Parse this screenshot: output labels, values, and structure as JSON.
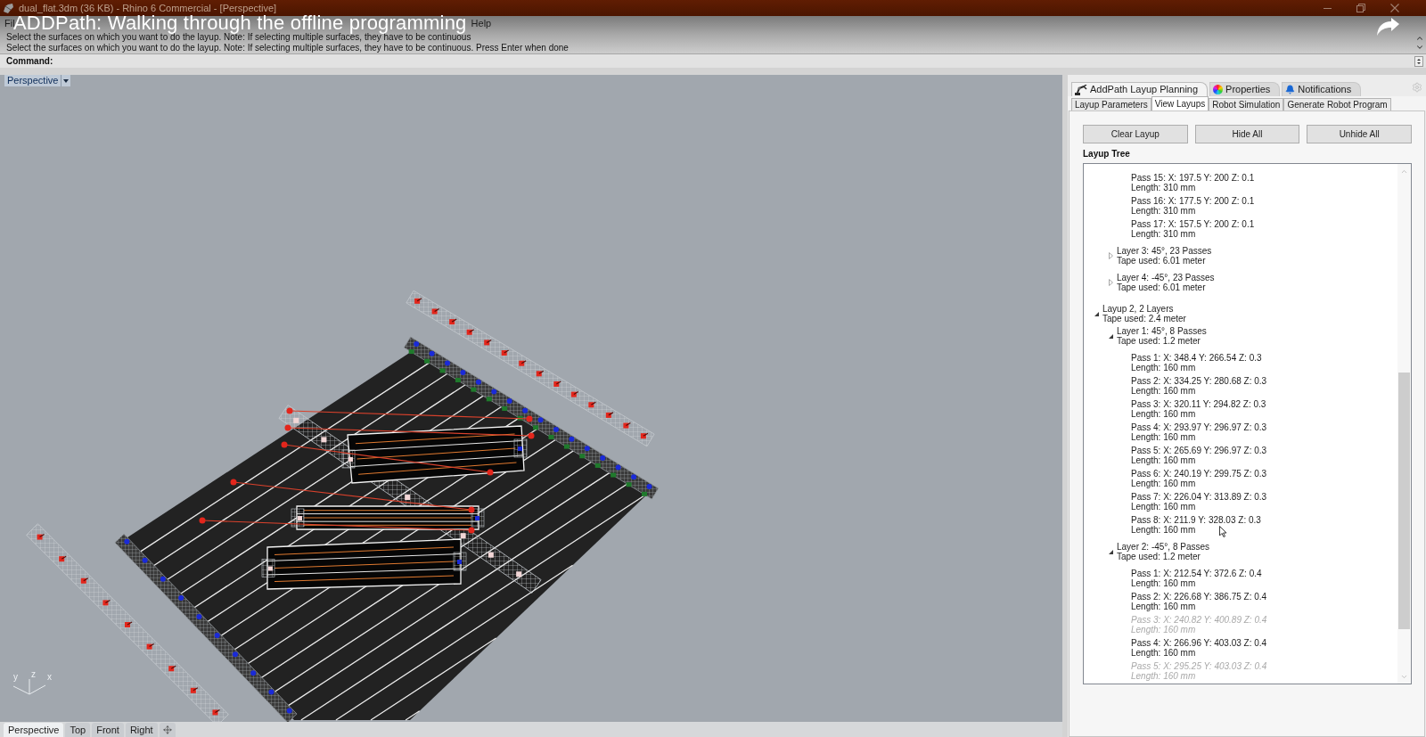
{
  "window": {
    "title": "dual_flat.3dm (36 KB) - Rhino 6 Commercial - [Perspective]"
  },
  "video_title": "ADDPath: Walking through the offline programming",
  "menu": [
    "Fil",
    "Help"
  ],
  "command_history": [
    "Select the surfaces on which you want to do the layup. Note: If selecting multiple surfaces, they have to be continuous",
    "Select the surfaces on which you want to do the layup. Note: If selecting multiple surfaces, they have to be continuous. Press Enter when done"
  ],
  "command": {
    "label": "Command:"
  },
  "viewport": {
    "label": "Perspective",
    "axis_labels": [
      "y",
      "z",
      "x"
    ],
    "tabs": [
      {
        "label": "Perspective",
        "selected": true
      },
      {
        "label": "Top",
        "selected": false
      },
      {
        "label": "Front",
        "selected": false
      },
      {
        "label": "Right",
        "selected": false
      }
    ]
  },
  "panel": {
    "tabs": [
      {
        "label": "AddPath Layup Planning",
        "selected": true
      },
      {
        "label": "Properties",
        "selected": false
      },
      {
        "label": "Notifications",
        "selected": false
      }
    ],
    "subtabs": [
      {
        "label": "Layup Parameters",
        "selected": false
      },
      {
        "label": "View Layups",
        "selected": true
      },
      {
        "label": "Robot Simulation",
        "selected": false
      },
      {
        "label": "Generate Robot Program",
        "selected": false
      }
    ],
    "buttons": [
      "Clear Layup",
      "Hide All",
      "Unhide All"
    ],
    "tree": {
      "title": "Layup Tree",
      "nodes": [
        {
          "kind": "layup",
          "expanded": true,
          "children": [
            {
              "kind": "layer",
              "expanded": true,
              "children": [
                {
                  "kind": "pass",
                  "label": "Pass 15: X: 197.5 Y: 200 Z: 0.1",
                  "detail": "Length: 310 mm",
                  "hidden": false
                },
                {
                  "kind": "pass",
                  "label": "Pass 16: X: 177.5 Y: 200 Z: 0.1",
                  "detail": "Length: 310 mm",
                  "hidden": false
                },
                {
                  "kind": "pass",
                  "label": "Pass 17: X: 157.5 Y: 200 Z: 0.1",
                  "detail": "Length: 310 mm",
                  "hidden": false
                }
              ]
            },
            {
              "kind": "layer",
              "label": "Layer 3: 45°, 23 Passes",
              "detail": "Tape used: 6.01 meter",
              "expanded": false
            },
            {
              "kind": "layer",
              "label": "Layer 4: -45°, 23 Passes",
              "detail": "Tape used: 6.01 meter",
              "expanded": false
            }
          ]
        },
        {
          "kind": "layup",
          "label": "Layup 2, 2 Layers",
          "detail": "Tape used: 2.4 meter",
          "expanded": true,
          "children": [
            {
              "kind": "layer",
              "label": "Layer 1: 45°, 8 Passes",
              "detail": "Tape used: 1.2 meter",
              "expanded": true,
              "children": [
                {
                  "kind": "pass",
                  "label": "Pass 1: X: 348.4 Y: 266.54 Z: 0.3",
                  "detail": "Length: 160 mm",
                  "hidden": false
                },
                {
                  "kind": "pass",
                  "label": "Pass 2: X: 334.25 Y: 280.68 Z: 0.3",
                  "detail": "Length: 160 mm",
                  "hidden": false
                },
                {
                  "kind": "pass",
                  "label": "Pass 3: X: 320.11 Y: 294.82 Z: 0.3",
                  "detail": "Length: 160 mm",
                  "hidden": false
                },
                {
                  "kind": "pass",
                  "label": "Pass 4: X: 293.97 Y: 296.97 Z: 0.3",
                  "detail": "Length: 160 mm",
                  "hidden": false
                },
                {
                  "kind": "pass",
                  "label": "Pass 5: X: 265.69 Y: 296.97 Z: 0.3",
                  "detail": "Length: 160 mm",
                  "hidden": false
                },
                {
                  "kind": "pass",
                  "label": "Pass 6: X: 240.19 Y: 299.75 Z: 0.3",
                  "detail": "Length: 160 mm",
                  "hidden": false
                },
                {
                  "kind": "pass",
                  "label": "Pass 7: X: 226.04 Y: 313.89 Z: 0.3",
                  "detail": "Length: 160 mm",
                  "hidden": false
                },
                {
                  "kind": "pass",
                  "label": "Pass 8: X: 211.9 Y: 328.03 Z: 0.3",
                  "detail": "Length: 160 mm",
                  "hidden": false
                }
              ]
            },
            {
              "kind": "layer",
              "label": "Layer 2: -45°, 8 Passes",
              "detail": "Tape used: 1.2 meter",
              "expanded": true,
              "children": [
                {
                  "kind": "pass",
                  "label": "Pass 1: X: 212.54 Y: 372.6 Z: 0.4",
                  "detail": "Length: 160 mm",
                  "hidden": false
                },
                {
                  "kind": "pass",
                  "label": "Pass 2: X: 226.68 Y: 386.75 Z: 0.4",
                  "detail": "Length: 160 mm",
                  "hidden": false
                },
                {
                  "kind": "pass",
                  "label": "Pass 3: X: 240.82 Y: 400.89 Z: 0.4",
                  "detail": "Length: 160 mm",
                  "hidden": true
                },
                {
                  "kind": "pass",
                  "label": "Pass 4: X: 266.96 Y: 403.03 Z: 0.4",
                  "detail": "Length: 160 mm",
                  "hidden": false
                },
                {
                  "kind": "pass",
                  "label": "Pass 5: X: 295.25 Y: 403.03 Z: 0.4",
                  "detail": "Length: 160 mm",
                  "hidden": true
                }
              ]
            }
          ]
        }
      ]
    }
  }
}
